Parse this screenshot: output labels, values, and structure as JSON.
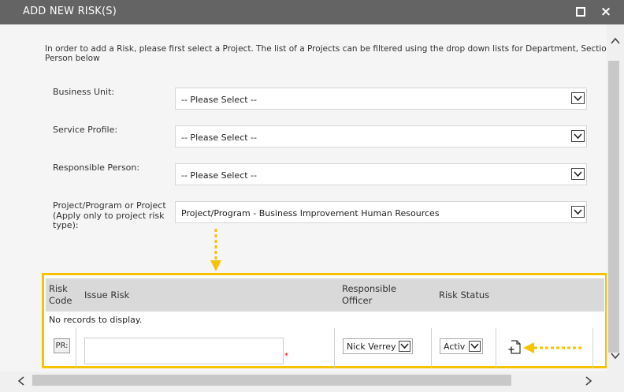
{
  "window": {
    "title": "ADD NEW RISK(S)",
    "maximize_icon": "maximize-icon",
    "close_icon": "close-icon",
    "close_symbol": "×"
  },
  "intro": {
    "line1": "In order to add a Risk, please first select a Project. The list of a Projects can be filtered using the drop down lists for Department, Sectio",
    "line2": "Person below"
  },
  "filters": [
    {
      "label": "Business Unit:",
      "value": "-- Please Select --"
    },
    {
      "label": "Service Profile:",
      "value": "-- Please Select --"
    },
    {
      "label": "Responsible Person:",
      "value": "-- Please Select --"
    },
    {
      "label_lines": [
        "Project/Program or Project",
        "(Apply only to project risk",
        "type):"
      ],
      "value": "Project/Program - Business Improvement Human Resources"
    }
  ],
  "grid": {
    "columns": {
      "risk_code": [
        "Risk",
        "Code"
      ],
      "issue_risk": "Issue Risk",
      "responsible_officer": [
        "Responsible",
        "Officer"
      ],
      "risk_status": "Risk Status"
    },
    "no_records": "No records to display.",
    "new_row": {
      "code_prefix": "PR:",
      "issue_value": "",
      "required_marker": "*",
      "officer": "Nick Verrey",
      "status": "Activ"
    }
  },
  "colors": {
    "titlebar": "#646464",
    "highlight": "#f5c400",
    "grid_header": "#d9d9d9"
  },
  "icons": {
    "new_record": "new-document-icon",
    "scroll_up": "chevron-up-icon",
    "scroll_down": "chevron-down-icon",
    "scroll_left": "chevron-left-icon",
    "scroll_right": "chevron-right-icon"
  }
}
